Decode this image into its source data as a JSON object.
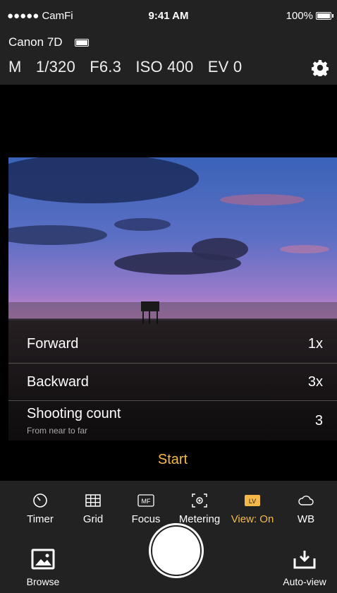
{
  "status": {
    "carrier": "●●●●● CamFi",
    "time": "9:41 AM",
    "battery": "100%"
  },
  "camera": {
    "name": "Canon 7D",
    "mode": "M",
    "shutter": "1/320",
    "aperture": "F6.3",
    "iso": "ISO 400",
    "ev": "EV 0"
  },
  "rows": [
    {
      "label": "Forward",
      "value": "1x"
    },
    {
      "label": "Backward",
      "value": "3x"
    },
    {
      "label": "Shooting count",
      "sublabel": "From near to far",
      "value": "3"
    }
  ],
  "start_label": "Start",
  "tools": [
    {
      "label": "Timer",
      "icon": "timer-icon"
    },
    {
      "label": "Grid",
      "icon": "grid-icon"
    },
    {
      "label": "Focus",
      "icon": "focus-icon",
      "badge": "MF"
    },
    {
      "label": "Metering",
      "icon": "metering-icon"
    },
    {
      "label": "View: On",
      "icon": "live-view-icon",
      "badge": "LV",
      "active": true
    },
    {
      "label": "WB",
      "icon": "white-balance-icon"
    }
  ],
  "bottom": {
    "browse": "Browse",
    "autoview": "Auto-view"
  },
  "colors": {
    "accent": "#f5b94a",
    "bar": "#222222"
  }
}
